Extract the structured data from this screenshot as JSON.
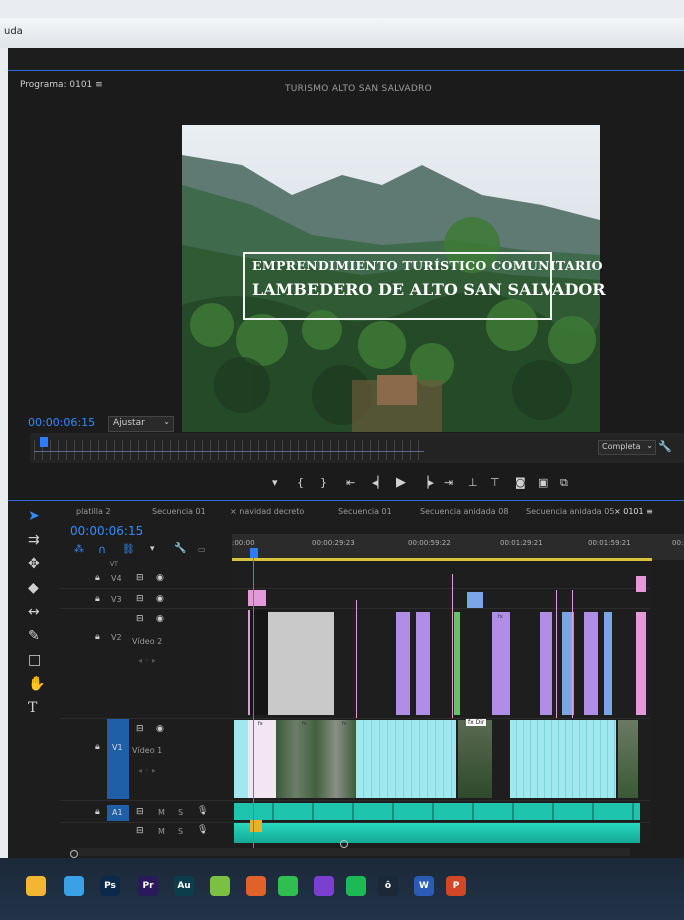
{
  "window": {
    "menu_fragment": "uda"
  },
  "program_monitor": {
    "tab_label": "Programa: 0101  ≡",
    "sequence_title": "TURISMO ALTO SAN SALVADRO",
    "title_overlay_line1": "EMPRENDIMIENTO TURÍSTICO COMUNITARIO",
    "title_overlay_line2": "LAMBEDERO DE ALTO SAN SALVADOR",
    "timecode": "00:00:06:15",
    "fit_value": "Ajustar",
    "quality_value": "Completa",
    "right_fragment": "00"
  },
  "timeline": {
    "tabs": [
      "platilla 2",
      "Secuencia 01",
      "navidad decreto",
      "Secuencia 01",
      "Secuencia anidada 08",
      "Secuencia anidada 05",
      "0101"
    ],
    "timecode": "00:00:06:15",
    "ruler_labels": [
      ":00:00",
      "00:00:29:23",
      "00:00:59:22",
      "00:01:29:21",
      "00:01:59:21",
      "00:"
    ],
    "tracks": {
      "v4": {
        "label": "V4"
      },
      "v3": {
        "label": "V3"
      },
      "v2": {
        "label": "V2",
        "name": "Vídeo 2"
      },
      "v1": {
        "label": "V1",
        "name": "Vídeo 1"
      },
      "a1": {
        "label": "A1",
        "m": "M",
        "s": "S"
      },
      "a2": {
        "m": "M",
        "s": "S"
      },
      "vt": {
        "label": "VT"
      }
    },
    "clip_labels": [
      "fx",
      "fx",
      "fx",
      "fx",
      "fx Dir"
    ]
  },
  "taskbar": {
    "apps": [
      {
        "name": "file-explorer",
        "label": "",
        "color": "#f2b632"
      },
      {
        "name": "photos",
        "label": "",
        "color": "#3aa1e6"
      },
      {
        "name": "photoshop",
        "label": "Ps",
        "color": "#0b2a4a"
      },
      {
        "name": "premiere",
        "label": "Pr",
        "color": "#2a1a5c"
      },
      {
        "name": "audition",
        "label": "Au",
        "color": "#0c3d4a"
      },
      {
        "name": "android",
        "label": "",
        "color": "#7bc043"
      },
      {
        "name": "hand-app",
        "label": "",
        "color": "#e0622a"
      },
      {
        "name": "whatsapp",
        "label": "",
        "color": "#2fbe4f"
      },
      {
        "name": "purple-app",
        "label": "",
        "color": "#7b3fd1"
      },
      {
        "name": "spotify",
        "label": "",
        "color": "#1db954"
      },
      {
        "name": "white-app",
        "label": "ô",
        "color": "#1b2838"
      },
      {
        "name": "word",
        "label": "W",
        "color": "#2b5cb5"
      },
      {
        "name": "powerpoint",
        "label": "P",
        "color": "#d24726"
      }
    ]
  }
}
